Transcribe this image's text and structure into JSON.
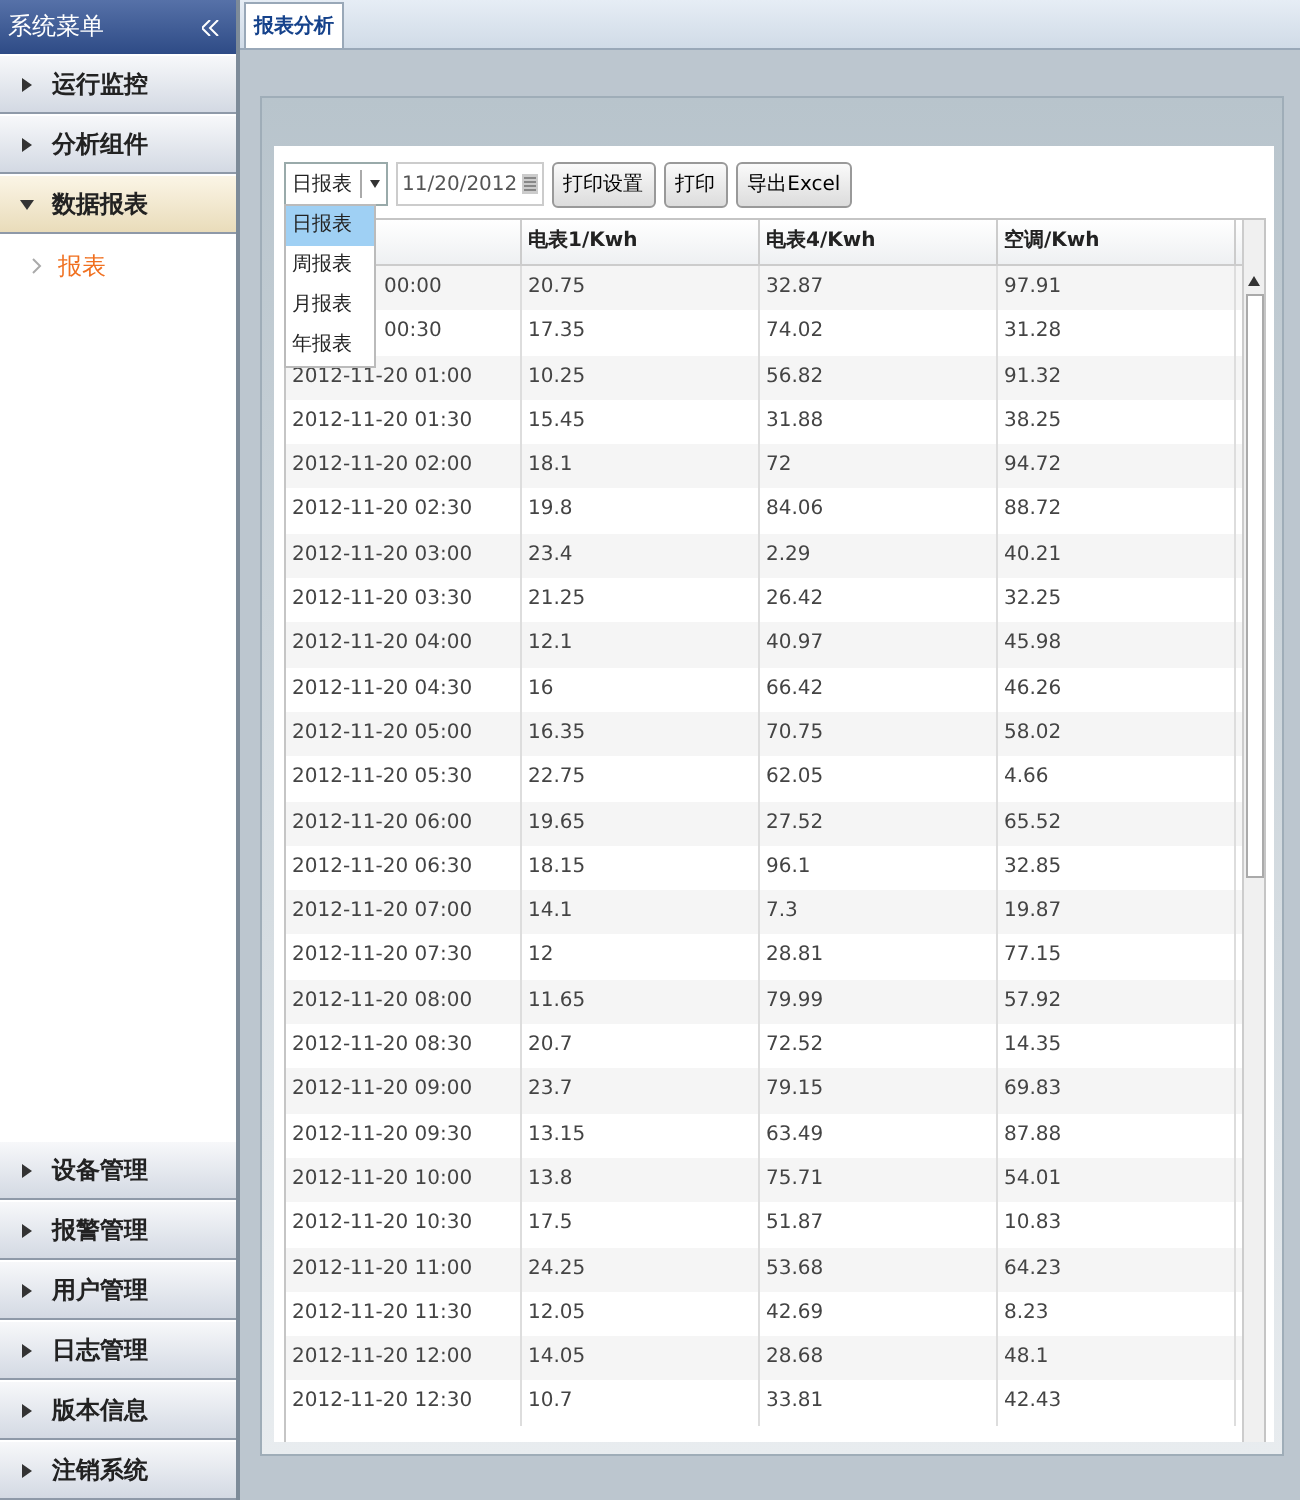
{
  "sidebar": {
    "title": "系统菜单",
    "groups": [
      {
        "label": "运行监控",
        "expanded": false
      },
      {
        "label": "分析组件",
        "expanded": false
      },
      {
        "label": "数据报表",
        "expanded": true,
        "children": [
          {
            "label": "报表",
            "selected": true
          }
        ]
      },
      {
        "label": "设备管理",
        "expanded": false
      },
      {
        "label": "报警管理",
        "expanded": false
      },
      {
        "label": "用户管理",
        "expanded": false
      },
      {
        "label": "日志管理",
        "expanded": false
      },
      {
        "label": "版本信息",
        "expanded": false
      },
      {
        "label": "注销系统",
        "expanded": false
      }
    ]
  },
  "tabs": [
    {
      "label": "报表分析",
      "selected": true
    }
  ],
  "toolbar": {
    "report_type": {
      "value": "日报表",
      "options": [
        {
          "label": "日报表",
          "selected": true
        },
        {
          "label": "周报表",
          "selected": false
        },
        {
          "label": "月报表",
          "selected": false
        },
        {
          "label": "年报表",
          "selected": false
        }
      ]
    },
    "date_field": {
      "value": "11/20/2012"
    },
    "buttons": [
      "打印设置",
      "打印",
      "导出Excel"
    ]
  },
  "table": {
    "columns": [
      "",
      "电表1/Kwh",
      "电表4/Kwh",
      "空调/Kwh"
    ],
    "rows": [
      [
        "00:00",
        "20.75",
        "32.87",
        "97.91"
      ],
      [
        "00:30",
        "17.35",
        "74.02",
        "31.28"
      ],
      [
        "2012-11-20 01:00",
        "10.25",
        "56.82",
        "91.32"
      ],
      [
        "2012-11-20 01:30",
        "15.45",
        "31.88",
        "38.25"
      ],
      [
        "2012-11-20 02:00",
        "18.1",
        "72",
        "94.72"
      ],
      [
        "2012-11-20 02:30",
        "19.8",
        "84.06",
        "88.72"
      ],
      [
        "2012-11-20 03:00",
        "23.4",
        "2.29",
        "40.21"
      ],
      [
        "2012-11-20 03:30",
        "21.25",
        "26.42",
        "32.25"
      ],
      [
        "2012-11-20 04:00",
        "12.1",
        "40.97",
        "45.98"
      ],
      [
        "2012-11-20 04:30",
        "16",
        "66.42",
        "46.26"
      ],
      [
        "2012-11-20 05:00",
        "16.35",
        "70.75",
        "58.02"
      ],
      [
        "2012-11-20 05:30",
        "22.75",
        "62.05",
        "4.66"
      ],
      [
        "2012-11-20 06:00",
        "19.65",
        "27.52",
        "65.52"
      ],
      [
        "2012-11-20 06:30",
        "18.15",
        "96.1",
        "32.85"
      ],
      [
        "2012-11-20 07:00",
        "14.1",
        "7.3",
        "19.87"
      ],
      [
        "2012-11-20 07:30",
        "12",
        "28.81",
        "77.15"
      ],
      [
        "2012-11-20 08:00",
        "11.65",
        "79.99",
        "57.92"
      ],
      [
        "2012-11-20 08:30",
        "20.7",
        "72.52",
        "14.35"
      ],
      [
        "2012-11-20 09:00",
        "23.7",
        "79.15",
        "69.83"
      ],
      [
        "2012-11-20 09:30",
        "13.15",
        "63.49",
        "87.88"
      ],
      [
        "2012-11-20 10:00",
        "13.8",
        "75.71",
        "54.01"
      ],
      [
        "2012-11-20 10:30",
        "17.5",
        "51.87",
        "10.83"
      ],
      [
        "2012-11-20 11:00",
        "24.25",
        "53.68",
        "64.23"
      ],
      [
        "2012-11-20 11:30",
        "12.05",
        "42.69",
        "8.23"
      ],
      [
        "2012-11-20 12:00",
        "14.05",
        "28.68",
        "48.1"
      ],
      [
        "2012-11-20 12:30",
        "10.7",
        "33.81",
        "42.43"
      ]
    ]
  }
}
